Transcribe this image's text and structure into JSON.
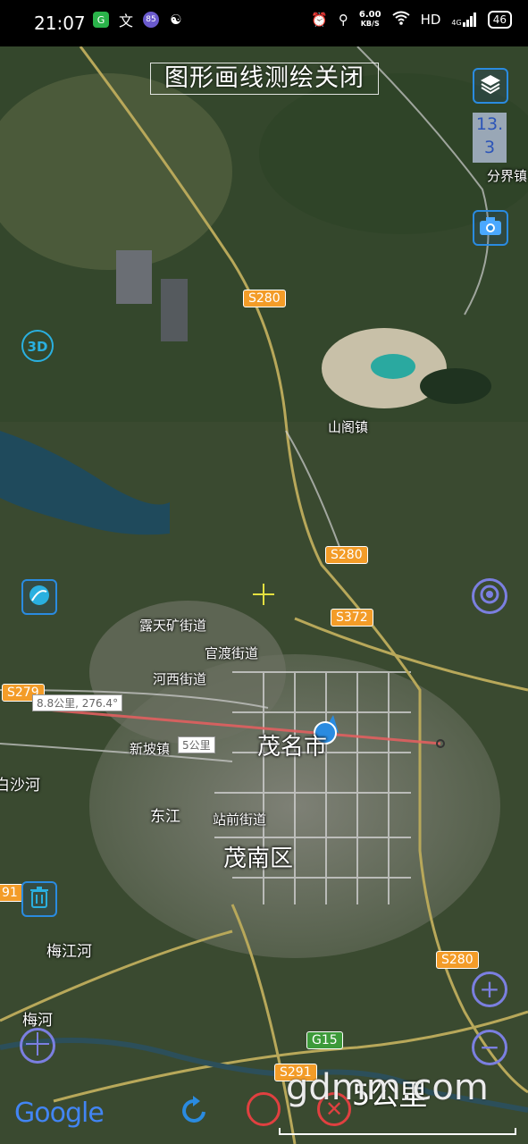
{
  "status_bar": {
    "time": "21:07",
    "speed_value": "6.00",
    "speed_unit": "KB/S",
    "network_hd": "HD",
    "network_4g": "4G",
    "battery": "46",
    "icons": [
      "app-green-icon",
      "wen-icon",
      "app-85-icon",
      "squirrel-icon",
      "alarm-icon",
      "location-icon",
      "wifi-icon",
      "signal-icon"
    ]
  },
  "toolbar": {
    "title": "图形画线测绘关闭",
    "zoom_level_line1": "13.",
    "zoom_level_line2": "3"
  },
  "places": {
    "fenjie": "分界镇",
    "shange": "山阁镇",
    "lutiankuang": "露天矿街道",
    "guandu": "官渡街道",
    "hexi": "河西街道",
    "maoming": "茂名市",
    "xinpo": "新坡镇",
    "dongjiang": "东江",
    "zhanqian": "站前街道",
    "maonan": "茂南区",
    "shahe": "白沙河",
    "meijianghe": "梅江河",
    "meihe": "梅河"
  },
  "roads": {
    "s280_top": "S280",
    "s280_mid": "S280",
    "s372": "S372",
    "s279": "S279",
    "s280_bottom": "S280",
    "g15": "G15",
    "s291": "S291",
    "road_91": "91"
  },
  "measure": {
    "distance_label": "8.8公里, 276.4°",
    "segment_label": "5公里"
  },
  "bottom": {
    "logo": "Google",
    "scale": "5公里",
    "watermark": "gdmm.com"
  },
  "colors": {
    "accent_blue": "#2a8be0",
    "control_purple": "#7b7fe0",
    "measure_line": "#e06060",
    "road_shield": "#f39c28"
  }
}
